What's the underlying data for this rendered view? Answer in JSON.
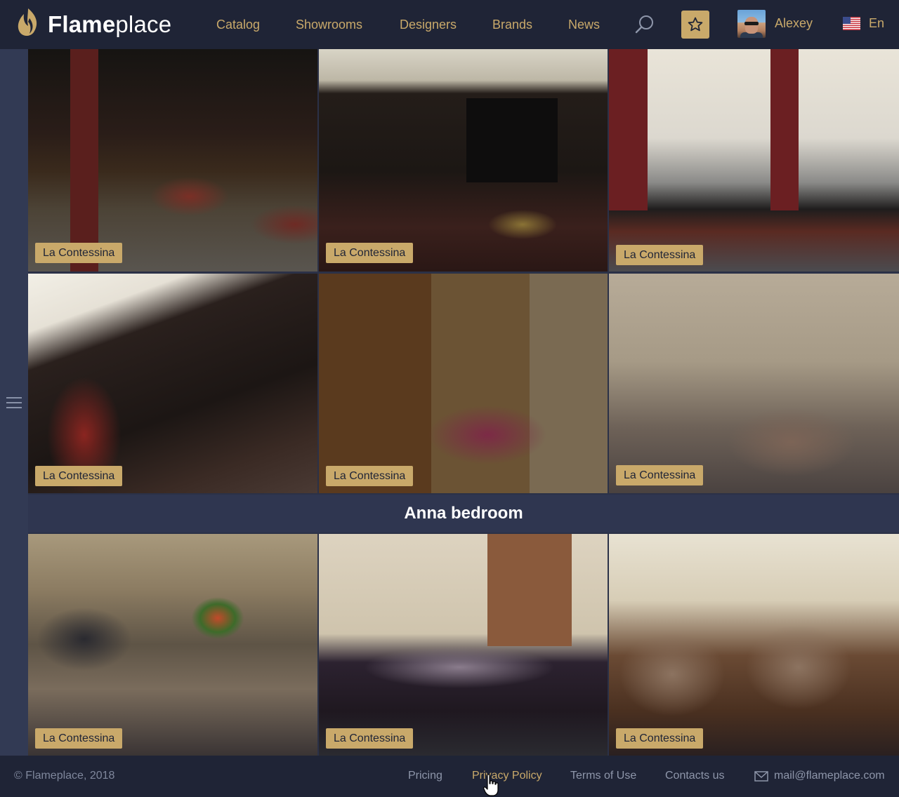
{
  "header": {
    "logo_bold": "Flame",
    "logo_light": "place",
    "nav": [
      "Catalog",
      "Showrooms",
      "Designers",
      "Brands",
      "News"
    ],
    "user_name": "Alexey",
    "language": "En"
  },
  "gallery": {
    "tag": "La Contessina",
    "section_title": "Anna bedroom",
    "tiles": [
      {
        "tag": "La Contessina"
      },
      {
        "tag": "La Contessina"
      },
      {
        "tag": "La Contessina"
      },
      {
        "tag": "La Contessina"
      },
      {
        "tag": "La Contessina"
      },
      {
        "tag": "La Contessina"
      },
      {
        "tag": "La Contessina"
      },
      {
        "tag": "La Contessina"
      },
      {
        "tag": "La Contessina"
      }
    ]
  },
  "footer": {
    "copyright": "© Flameplace, 2018",
    "links": [
      "Pricing",
      "Privacy Policy",
      "Terms of Use",
      "Contacts us"
    ],
    "email": "mail@flameplace.com"
  },
  "colors": {
    "accent": "#c9a96a",
    "header_bg": "#1f2436",
    "page_bg": "#2b3147"
  },
  "icons": [
    "flame-logo-icon",
    "search-icon",
    "star-icon",
    "menu-icon",
    "us-flag-icon",
    "mail-icon",
    "hand-cursor-icon"
  ]
}
